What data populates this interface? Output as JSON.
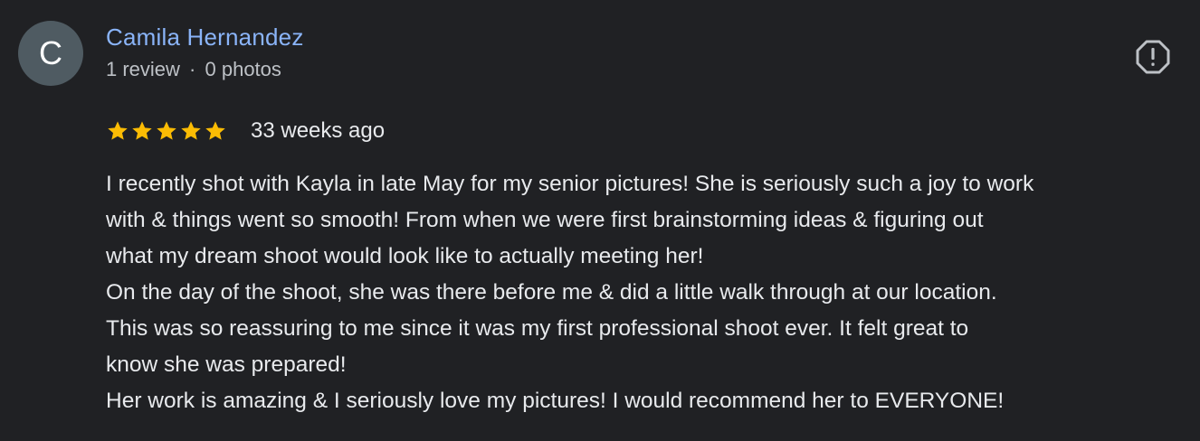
{
  "reviewer": {
    "initial": "C",
    "name": "Camila Hernandez",
    "review_count": "1 review",
    "separator": "·",
    "photo_count": "0 photos",
    "avatar_color": "#4f5b62",
    "name_color": "#8ab4f8"
  },
  "report_icon": "report-flag-icon",
  "rating": {
    "stars": 5,
    "max_stars": 5,
    "star_color": "#fbbc04",
    "date": "33 weeks ago"
  },
  "review": {
    "lines": [
      "I recently shot with Kayla in late May for my senior pictures! She is seriously such a joy to work",
      "with & things went so smooth! From when we were first brainstorming ideas & figuring out",
      "what my dream shoot would look like to actually meeting her!",
      "On the day of the shoot, she was there before me & did a little walk through at our location.",
      "This was so reassuring to me since it was my first professional shoot ever. It felt great to",
      "know she was prepared!",
      "Her work is amazing & I seriously love my pictures! I would recommend her to EVERYONE!"
    ]
  }
}
